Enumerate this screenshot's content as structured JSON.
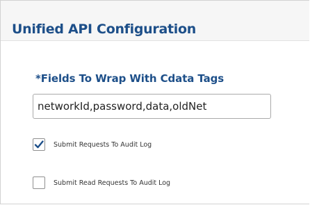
{
  "panel": {
    "title": "Unified API Configuration"
  },
  "cdata_field": {
    "label": "*Fields To Wrap With Cdata Tags",
    "value": "networkId,password,data,oldNet"
  },
  "options": [
    {
      "label": "Submit Requests To Audit Log",
      "checked": true
    },
    {
      "label": "Submit Read Requests To Audit Log",
      "checked": false
    }
  ],
  "colors": {
    "heading": "#1d4f89",
    "check": "#1d4f89"
  },
  "icons": {
    "checkmark": "check-icon"
  }
}
